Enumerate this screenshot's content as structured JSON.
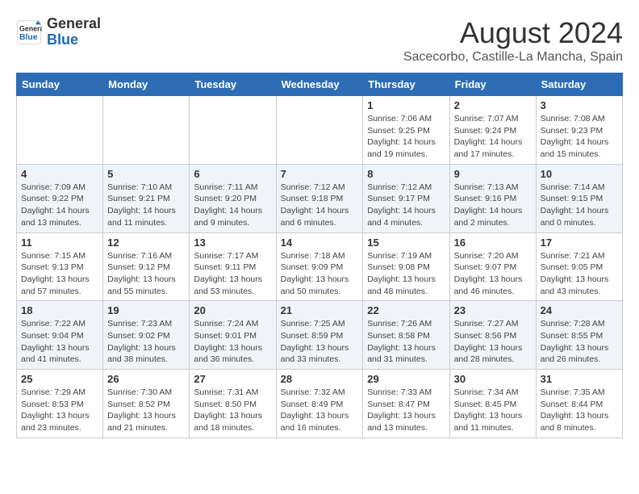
{
  "header": {
    "logo_line1": "General",
    "logo_line2": "Blue",
    "month": "August 2024",
    "location": "Sacecorbo, Castille-La Mancha, Spain"
  },
  "weekdays": [
    "Sunday",
    "Monday",
    "Tuesday",
    "Wednesday",
    "Thursday",
    "Friday",
    "Saturday"
  ],
  "weeks": [
    [
      {
        "day": "",
        "info": ""
      },
      {
        "day": "",
        "info": ""
      },
      {
        "day": "",
        "info": ""
      },
      {
        "day": "",
        "info": ""
      },
      {
        "day": "1",
        "info": "Sunrise: 7:06 AM\nSunset: 9:25 PM\nDaylight: 14 hours\nand 19 minutes."
      },
      {
        "day": "2",
        "info": "Sunrise: 7:07 AM\nSunset: 9:24 PM\nDaylight: 14 hours\nand 17 minutes."
      },
      {
        "day": "3",
        "info": "Sunrise: 7:08 AM\nSunset: 9:23 PM\nDaylight: 14 hours\nand 15 minutes."
      }
    ],
    [
      {
        "day": "4",
        "info": "Sunrise: 7:09 AM\nSunset: 9:22 PM\nDaylight: 14 hours\nand 13 minutes."
      },
      {
        "day": "5",
        "info": "Sunrise: 7:10 AM\nSunset: 9:21 PM\nDaylight: 14 hours\nand 11 minutes."
      },
      {
        "day": "6",
        "info": "Sunrise: 7:11 AM\nSunset: 9:20 PM\nDaylight: 14 hours\nand 9 minutes."
      },
      {
        "day": "7",
        "info": "Sunrise: 7:12 AM\nSunset: 9:18 PM\nDaylight: 14 hours\nand 6 minutes."
      },
      {
        "day": "8",
        "info": "Sunrise: 7:12 AM\nSunset: 9:17 PM\nDaylight: 14 hours\nand 4 minutes."
      },
      {
        "day": "9",
        "info": "Sunrise: 7:13 AM\nSunset: 9:16 PM\nDaylight: 14 hours\nand 2 minutes."
      },
      {
        "day": "10",
        "info": "Sunrise: 7:14 AM\nSunset: 9:15 PM\nDaylight: 14 hours\nand 0 minutes."
      }
    ],
    [
      {
        "day": "11",
        "info": "Sunrise: 7:15 AM\nSunset: 9:13 PM\nDaylight: 13 hours\nand 57 minutes."
      },
      {
        "day": "12",
        "info": "Sunrise: 7:16 AM\nSunset: 9:12 PM\nDaylight: 13 hours\nand 55 minutes."
      },
      {
        "day": "13",
        "info": "Sunrise: 7:17 AM\nSunset: 9:11 PM\nDaylight: 13 hours\nand 53 minutes."
      },
      {
        "day": "14",
        "info": "Sunrise: 7:18 AM\nSunset: 9:09 PM\nDaylight: 13 hours\nand 50 minutes."
      },
      {
        "day": "15",
        "info": "Sunrise: 7:19 AM\nSunset: 9:08 PM\nDaylight: 13 hours\nand 48 minutes."
      },
      {
        "day": "16",
        "info": "Sunrise: 7:20 AM\nSunset: 9:07 PM\nDaylight: 13 hours\nand 46 minutes."
      },
      {
        "day": "17",
        "info": "Sunrise: 7:21 AM\nSunset: 9:05 PM\nDaylight: 13 hours\nand 43 minutes."
      }
    ],
    [
      {
        "day": "18",
        "info": "Sunrise: 7:22 AM\nSunset: 9:04 PM\nDaylight: 13 hours\nand 41 minutes."
      },
      {
        "day": "19",
        "info": "Sunrise: 7:23 AM\nSunset: 9:02 PM\nDaylight: 13 hours\nand 38 minutes."
      },
      {
        "day": "20",
        "info": "Sunrise: 7:24 AM\nSunset: 9:01 PM\nDaylight: 13 hours\nand 36 minutes."
      },
      {
        "day": "21",
        "info": "Sunrise: 7:25 AM\nSunset: 8:59 PM\nDaylight: 13 hours\nand 33 minutes."
      },
      {
        "day": "22",
        "info": "Sunrise: 7:26 AM\nSunset: 8:58 PM\nDaylight: 13 hours\nand 31 minutes."
      },
      {
        "day": "23",
        "info": "Sunrise: 7:27 AM\nSunset: 8:56 PM\nDaylight: 13 hours\nand 28 minutes."
      },
      {
        "day": "24",
        "info": "Sunrise: 7:28 AM\nSunset: 8:55 PM\nDaylight: 13 hours\nand 26 minutes."
      }
    ],
    [
      {
        "day": "25",
        "info": "Sunrise: 7:29 AM\nSunset: 8:53 PM\nDaylight: 13 hours\nand 23 minutes."
      },
      {
        "day": "26",
        "info": "Sunrise: 7:30 AM\nSunset: 8:52 PM\nDaylight: 13 hours\nand 21 minutes."
      },
      {
        "day": "27",
        "info": "Sunrise: 7:31 AM\nSunset: 8:50 PM\nDaylight: 13 hours\nand 18 minutes."
      },
      {
        "day": "28",
        "info": "Sunrise: 7:32 AM\nSunset: 8:49 PM\nDaylight: 13 hours\nand 16 minutes."
      },
      {
        "day": "29",
        "info": "Sunrise: 7:33 AM\nSunset: 8:47 PM\nDaylight: 13 hours\nand 13 minutes."
      },
      {
        "day": "30",
        "info": "Sunrise: 7:34 AM\nSunset: 8:45 PM\nDaylight: 13 hours\nand 11 minutes."
      },
      {
        "day": "31",
        "info": "Sunrise: 7:35 AM\nSunset: 8:44 PM\nDaylight: 13 hours\nand 8 minutes."
      }
    ]
  ]
}
